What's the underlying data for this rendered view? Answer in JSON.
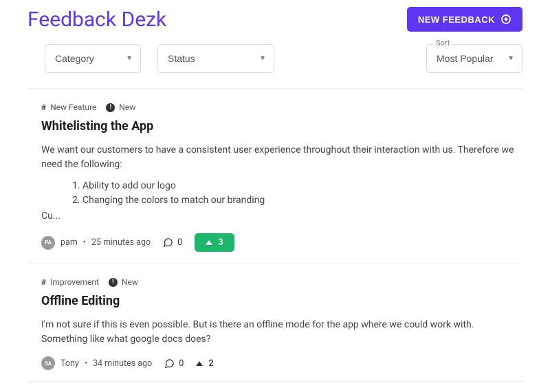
{
  "header": {
    "title": "Feedback Dezk",
    "new_button": "NEW FEEDBACK"
  },
  "filters": {
    "category": {
      "label": "Category",
      "value": "Category"
    },
    "status": {
      "label": "Status",
      "value": "Status"
    },
    "sort": {
      "label": "Sort",
      "value": "Most Popular"
    }
  },
  "posts": [
    {
      "category": "New Feature",
      "status": "New",
      "title": "Whitelisting the App",
      "body_intro": "We want our customers to have a consistent user experience throughout their interaction with us. Therefore we need the following:",
      "body_list": [
        "Ability to add our logo",
        "Changing the colors to match our branding"
      ],
      "body_tail": "Cu...",
      "author_initials": "PA",
      "author": "pam",
      "time": "25 minutes ago",
      "comments": 0,
      "upvotes": 3,
      "upvote_style": "green"
    },
    {
      "category": "Improvement",
      "status": "New",
      "title": "Offline Editing",
      "body_intro": "I'm not sure if this is even possible. But is there an offline mode for the app where we could work with. Something like what google docs does?",
      "body_list": [],
      "body_tail": "",
      "author_initials": "SA",
      "author": "Tony",
      "time": "34 minutes ago",
      "comments": 0,
      "upvotes": 2,
      "upvote_style": "plain"
    }
  ]
}
